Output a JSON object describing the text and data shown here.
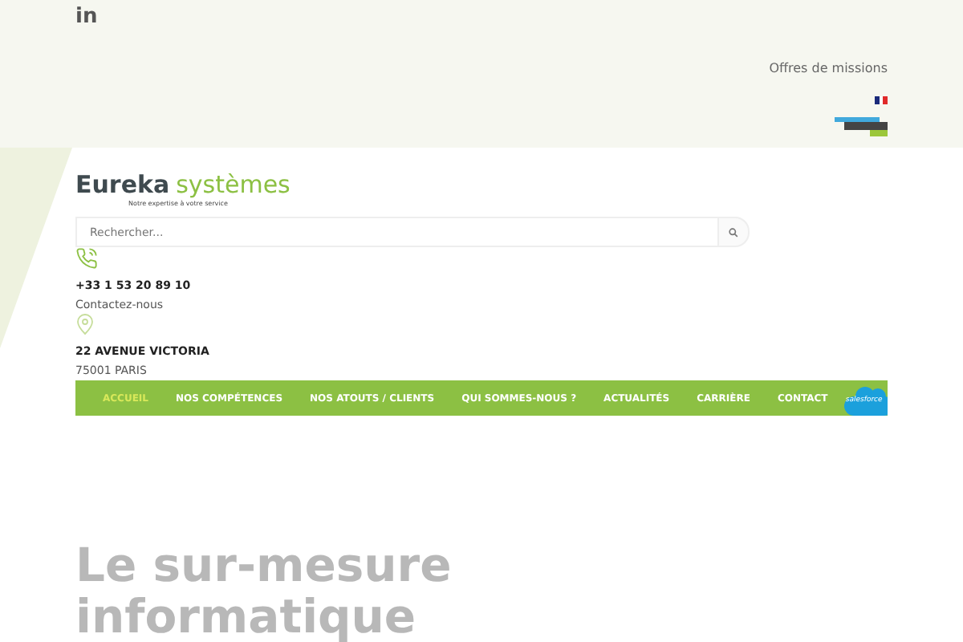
{
  "topbar": {
    "social": "in",
    "links": [
      "Offres de missions"
    ],
    "language": {
      "kind": "flag-fr"
    }
  },
  "logo": {
    "name": "Eureka",
    "accent": "systèmes",
    "tagline": "Notre expertise à votre service"
  },
  "search": {
    "placeholder": "Rechercher..."
  },
  "contacts": [
    {
      "kind": "phone",
      "title": "+33 1 53 20 89 10",
      "subtitle": "Contactez-nous"
    },
    {
      "kind": "location",
      "title": "22 AVENUE VICTORIA",
      "subtitle": "75001 PARIS"
    }
  ],
  "nav": {
    "items": [
      {
        "label": "ACCUEIL",
        "selected": true
      },
      {
        "label": "NOS COMPÉTENCES",
        "selected": false
      },
      {
        "label": "NOS ATOUTS / CLIENTS",
        "selected": false
      },
      {
        "label": "QUI SOMMES-NOUS ?",
        "selected": false
      },
      {
        "label": "ACTUALITÉS",
        "selected": false
      },
      {
        "label": "CARRIÈRE",
        "selected": false
      },
      {
        "label": "CONTACT",
        "selected": false
      }
    ],
    "badge": "salesforce"
  },
  "hero": {
    "lines": [
      "Le sur-mesure",
      "informatique"
    ]
  }
}
